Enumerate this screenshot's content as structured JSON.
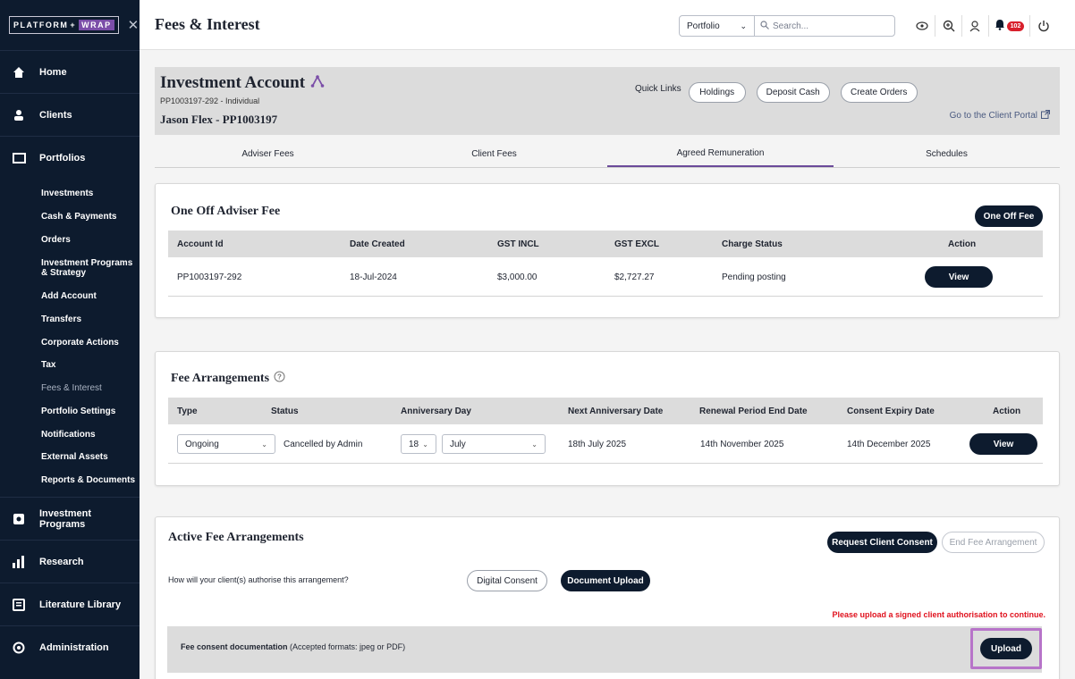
{
  "brand": {
    "name": "PLATFORM",
    "plus": "+",
    "wrap": "WRAP"
  },
  "sidebar": {
    "main_top": [
      {
        "label": "Home",
        "icon": "home-icon"
      },
      {
        "label": "Clients",
        "icon": "user-icon"
      },
      {
        "label": "Portfolios",
        "icon": "folder-icon"
      }
    ],
    "sub": [
      "Investments",
      "Cash & Payments",
      "Orders",
      "Investment Programs & Strategy",
      "Add Account",
      "Transfers",
      "Corporate Actions",
      "Tax",
      "Fees & Interest",
      "Portfolio Settings",
      "Notifications",
      "External Assets",
      "Reports & Documents"
    ],
    "main_bottom": [
      {
        "label": "Investment Programs",
        "icon": "gear-box-icon"
      },
      {
        "label": "Research",
        "icon": "bar-chart-icon"
      },
      {
        "label": "Literature Library",
        "icon": "book-icon"
      },
      {
        "label": "Administration",
        "icon": "admin-icon"
      }
    ]
  },
  "header": {
    "title": "Fees & Interest",
    "search_scope": "Portfolio",
    "search_placeholder": "Search...",
    "notification_count": "102"
  },
  "account": {
    "title": "Investment Account",
    "sub": "PP1003197-292 - Individual",
    "name": "Jason Flex - PP1003197",
    "quick_links_label": "Quick Links",
    "quick_links": [
      "Holdings",
      "Deposit Cash",
      "Create Orders"
    ],
    "portal_link": "Go to the Client Portal"
  },
  "tabs": [
    "Adviser Fees",
    "Client Fees",
    "Agreed Remuneration",
    "Schedules"
  ],
  "one_off": {
    "title": "One Off Adviser Fee",
    "button": "One Off Fee",
    "columns": [
      "Account Id",
      "Date Created",
      "GST INCL",
      "GST EXCL",
      "Charge Status",
      "Action"
    ],
    "row": {
      "account_id": "PP1003197-292",
      "date": "18-Jul-2024",
      "gst_incl": "$3,000.00",
      "gst_excl": "$2,727.27",
      "status": "Pending posting",
      "action": "View"
    }
  },
  "fee_arr": {
    "title": "Fee Arrangements",
    "columns": [
      "Type",
      "Status",
      "Anniversary Day",
      "Next Anniversary Date",
      "Renewal Period End Date",
      "Consent Expiry Date",
      "Action"
    ],
    "row": {
      "type": "Ongoing",
      "status": "Cancelled by Admin",
      "day": "18",
      "month": "July",
      "next": "18th July 2025",
      "renewal": "14th November 2025",
      "expiry": "14th December 2025",
      "action": "View"
    }
  },
  "active": {
    "title": "Active Fee Arrangements",
    "request_btn": "Request Client Consent",
    "end_btn": "End Fee Arrangement",
    "question": "How will your client(s) authorise this arrangement?",
    "digital": "Digital Consent",
    "document": "Document Upload",
    "warning": "Please upload a signed client authorisation to continue.",
    "upload_label_bold": "Fee consent documentation",
    "upload_label_rest": " (Accepted formats: jpeg or PDF)",
    "upload_btn": "Upload"
  },
  "colors": {
    "navy": "#0d1b2e",
    "accent": "#6b4a9a",
    "warning": "#e0121e",
    "highlight": "#b774c9"
  }
}
